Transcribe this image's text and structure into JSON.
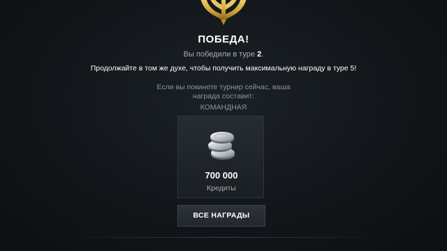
{
  "result": {
    "title": "ПОБЕДА!",
    "round_prefix": "Вы победили в туре",
    "round_number": "2",
    "round_suffix": ".",
    "continue_text": "Продолжайте в том же духе, чтобы получить максимальную награду в туре 5!",
    "leave_note": "Если вы покинете турнир сейчас, ваша награда составит:",
    "team_label": "КОМАНДНАЯ"
  },
  "reward": {
    "amount": "700 000",
    "type": "Кредиты",
    "icon": "silver-coins-icon"
  },
  "buttons": {
    "all_rewards": "ВСЕ НАГРАДЫ"
  },
  "emblem": {
    "icon": "victory-laurel-emblem-icon",
    "color": "#d4a73a"
  }
}
